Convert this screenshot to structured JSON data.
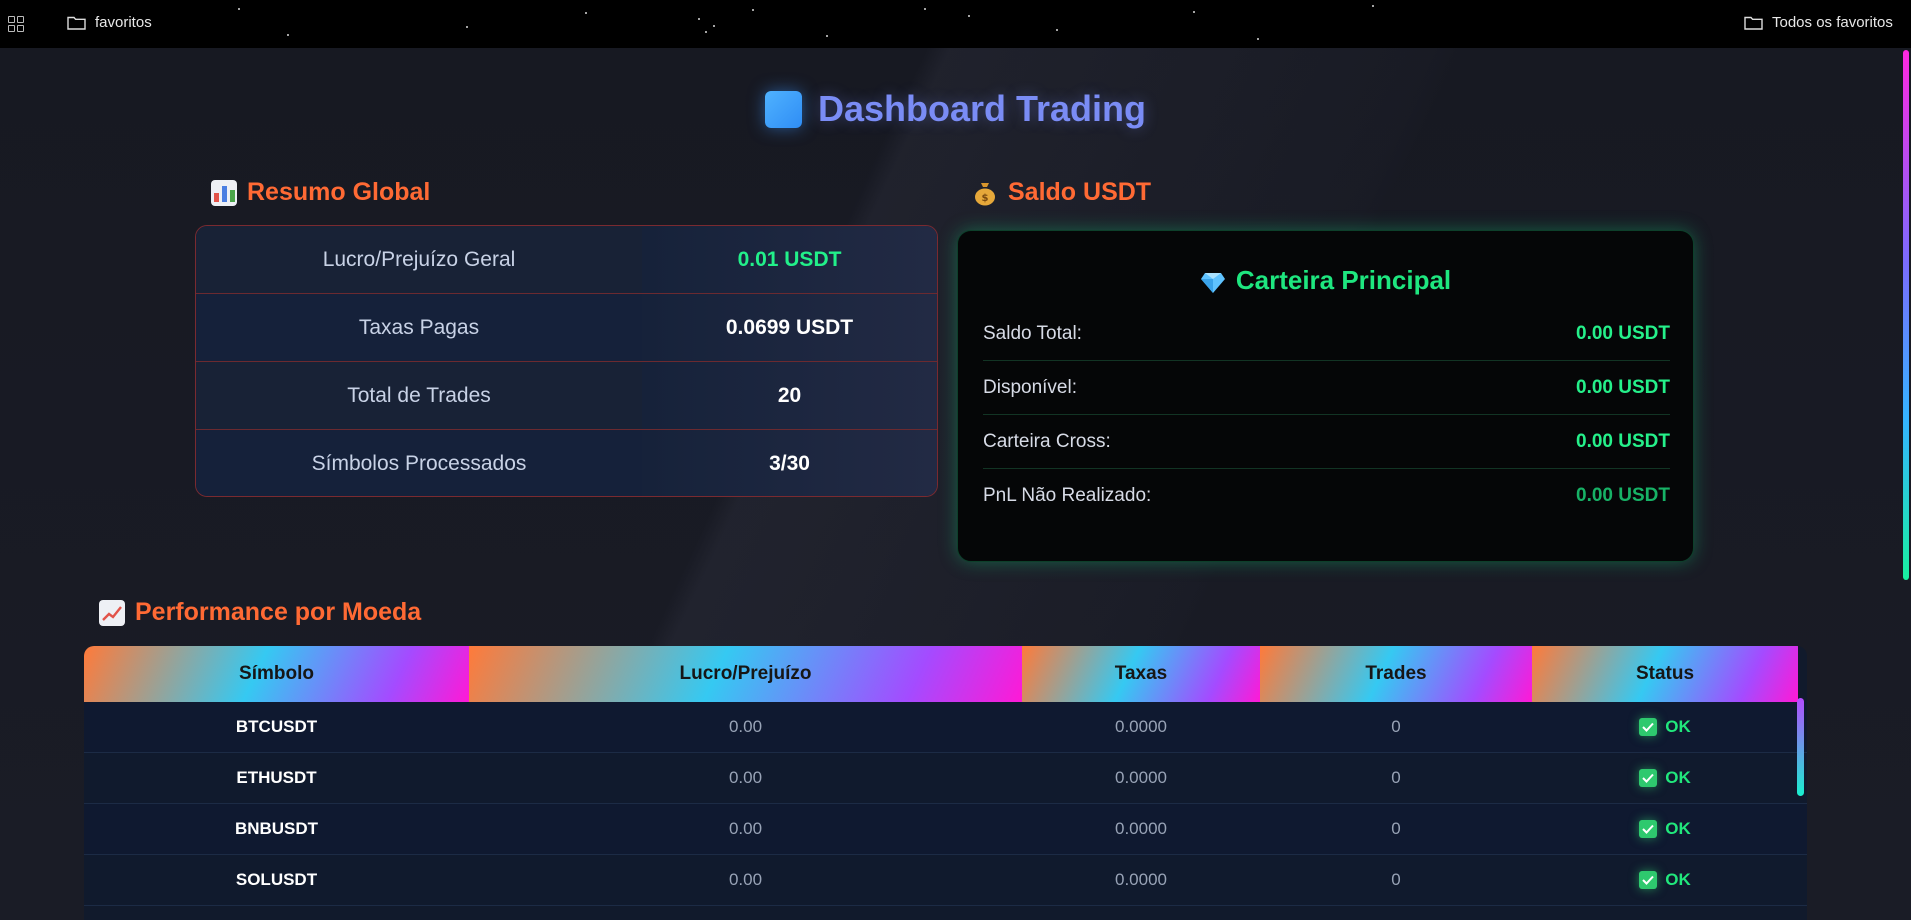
{
  "bookmarks": {
    "left_folder": "favoritos",
    "right_folder": "Todos os favoritos"
  },
  "page": {
    "title": "Dashboard Trading"
  },
  "resumo": {
    "heading": "Resumo Global",
    "rows": [
      {
        "label": "Lucro/Prejuízo Geral",
        "value": "0.01 USDT",
        "highlight": "green"
      },
      {
        "label": "Taxas Pagas",
        "value": "0.0699 USDT"
      },
      {
        "label": "Total de Trades",
        "value": "20"
      },
      {
        "label": "Símbolos Processados",
        "value": "3/30"
      }
    ]
  },
  "saldo": {
    "heading": "Saldo USDT",
    "card_title": "Carteira Principal",
    "rows": [
      {
        "label": "Saldo Total:",
        "value": "0.00 USDT"
      },
      {
        "label": "Disponível:",
        "value": "0.00 USDT"
      },
      {
        "label": "Carteira Cross:",
        "value": "0.00 USDT"
      },
      {
        "label": "PnL Não Realizado:",
        "value": "0.00 USDT"
      }
    ]
  },
  "performance": {
    "heading": "Performance por Moeda",
    "columns": [
      "Símbolo",
      "Lucro/Prejuízo",
      "Taxas",
      "Trades",
      "Status"
    ],
    "rows": [
      {
        "symbol": "BTCUSDT",
        "pnl": "0.00",
        "fees": "0.0000",
        "trades": "0",
        "status": "OK"
      },
      {
        "symbol": "ETHUSDT",
        "pnl": "0.00",
        "fees": "0.0000",
        "trades": "0",
        "status": "OK"
      },
      {
        "symbol": "BNBUSDT",
        "pnl": "0.00",
        "fees": "0.0000",
        "trades": "0",
        "status": "OK"
      },
      {
        "symbol": "SOLUSDT",
        "pnl": "0.00",
        "fees": "0.0000",
        "trades": "0",
        "status": "OK"
      }
    ]
  },
  "colors": {
    "accent_title": "#7a8cf5",
    "section_heading": "#ff6a34",
    "positive": "#22f08a"
  }
}
